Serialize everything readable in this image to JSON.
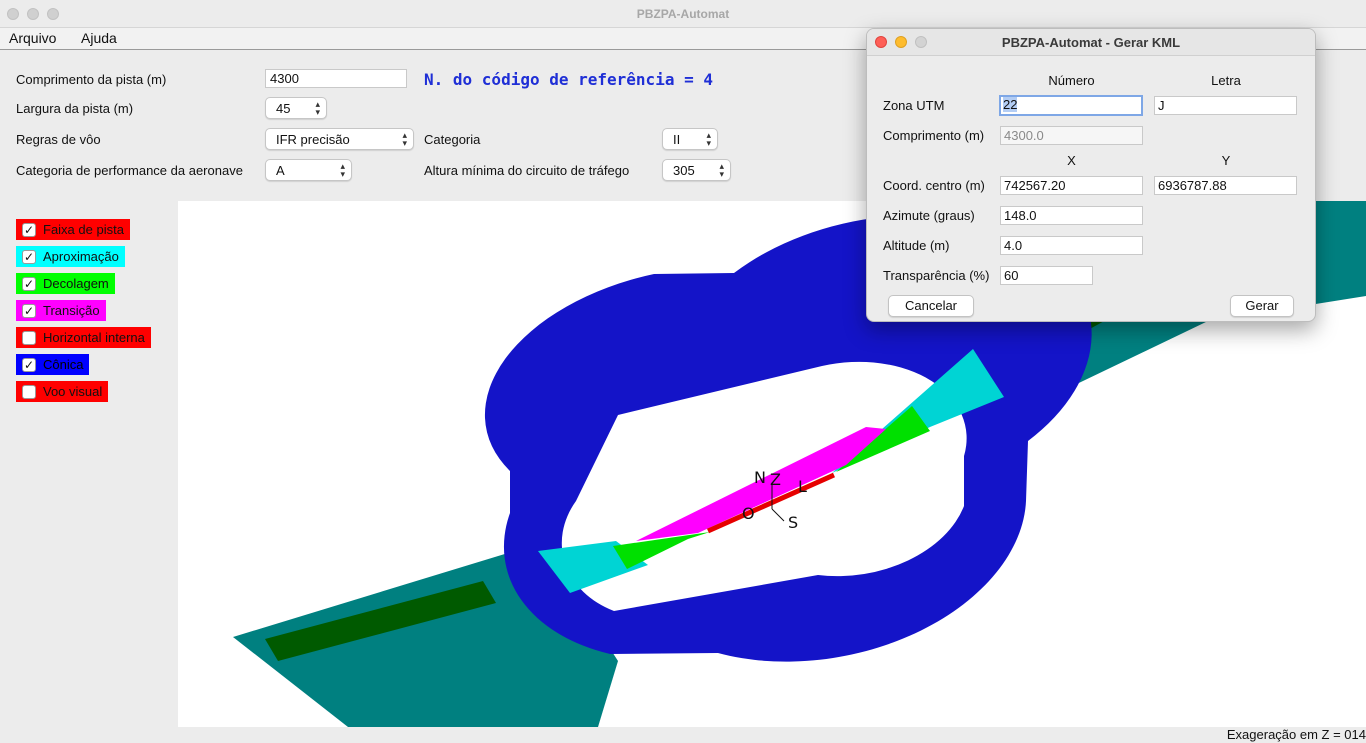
{
  "window": {
    "title": "PBZPA-Automat"
  },
  "menu": {
    "items": [
      "Arquivo",
      "Ajuda"
    ]
  },
  "form": {
    "runway_length": {
      "label": "Comprimento da pista (m)",
      "value": "4300"
    },
    "runway_width": {
      "label": "Largura da pista (m)",
      "value": "45"
    },
    "flight_rules": {
      "label": "Regras de vôo",
      "value": "IFR precisão"
    },
    "category": {
      "label": "Categoria",
      "value": "II"
    },
    "aircraft_performance": {
      "label": "Categoria de performance da aeronave",
      "value": "A"
    },
    "traffic_circuit_height": {
      "label": "Altura mínima do circuito de tráfego",
      "value": "305"
    },
    "reference_code": "N. do código de referência = 4"
  },
  "layers": [
    {
      "label": "Faixa de pista",
      "checked": true,
      "color": "#ff0000"
    },
    {
      "label": "Aproximação",
      "checked": true,
      "color": "#00ffff"
    },
    {
      "label": "Decolagem",
      "checked": true,
      "color": "#00ff00"
    },
    {
      "label": "Transição",
      "checked": true,
      "color": "#ff00ff"
    },
    {
      "label": "Horizontal interna",
      "checked": false,
      "color": "#ff0000"
    },
    {
      "label": "Cônica",
      "checked": true,
      "color": "#0000ff"
    },
    {
      "label": "Voo visual",
      "checked": false,
      "color": "#ff0000"
    }
  ],
  "view": {
    "compass": {
      "n": "N",
      "z": "Z",
      "l": "L",
      "o": "O",
      "s": "S"
    },
    "colors": {
      "conical": "#1414c8",
      "approach_outer": "#008080",
      "approach_inner": "#00d4d4",
      "takeoff": "#00e000",
      "takeoff_dark": "#005a00",
      "transition": "#ff00ff",
      "strip": "#e60000"
    }
  },
  "status": {
    "z_exaggeration": "Exageração em Z = 014"
  },
  "dialog": {
    "title": "PBZPA-Automat - Gerar KML",
    "col_number": "Número",
    "col_letter": "Letra",
    "col_x": "X",
    "col_y": "Y",
    "utm_zone": {
      "label": "Zona UTM",
      "number": "22",
      "letter": "J"
    },
    "length": {
      "label": "Comprimento (m)",
      "value": "4300.0"
    },
    "center": {
      "label": "Coord. centro (m)",
      "x": "742567.20",
      "y": "6936787.88"
    },
    "azimuth": {
      "label": "Azimute (graus)",
      "value": "148.0"
    },
    "altitude": {
      "label": "Altitude (m)",
      "value": "4.0"
    },
    "transparency": {
      "label": "Transparência (%)",
      "value": "60"
    },
    "cancel_label": "Cancelar",
    "generate_label": "Gerar"
  }
}
